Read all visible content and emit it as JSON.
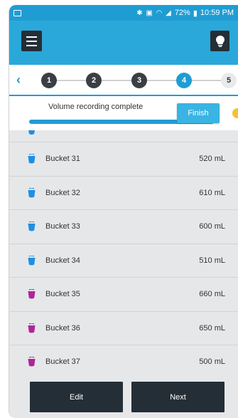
{
  "status_bar": {
    "icons": [
      "bluetooth-icon",
      "vibrate-icon",
      "wifi-icon",
      "signal-icon"
    ],
    "battery": "72%",
    "time": "10:59 PM"
  },
  "app_bar": {
    "menu_icon": "hamburger-menu-icon",
    "tip_icon": "lightbulb-icon"
  },
  "stepper": {
    "steps": [
      "1",
      "2",
      "3",
      "4",
      "5"
    ],
    "active_index": 3
  },
  "banner": {
    "message": "Volume recording complete",
    "progress_fraction": 1.0,
    "finish_label": "Finish"
  },
  "buckets": [
    {
      "name": "Bucket 31",
      "volume": "520 mL",
      "color": "#1f8fe0"
    },
    {
      "name": "Bucket 32",
      "volume": "610 mL",
      "color": "#1f8fe0"
    },
    {
      "name": "Bucket 33",
      "volume": "600 mL",
      "color": "#1f8fe0"
    },
    {
      "name": "Bucket 34",
      "volume": "510 mL",
      "color": "#1f8fe0"
    },
    {
      "name": "Bucket 35",
      "volume": "660 mL",
      "color": "#b0249b"
    },
    {
      "name": "Bucket 36",
      "volume": "650 mL",
      "color": "#b0249b"
    },
    {
      "name": "Bucket 37",
      "volume": "500 mL",
      "color": "#b0249b"
    }
  ],
  "footer": {
    "edit_label": "Edit",
    "next_label": "Next"
  },
  "colors": {
    "primary": "#2aa8d9",
    "dark": "#242e36",
    "accent_yellow": "#f3c233"
  }
}
